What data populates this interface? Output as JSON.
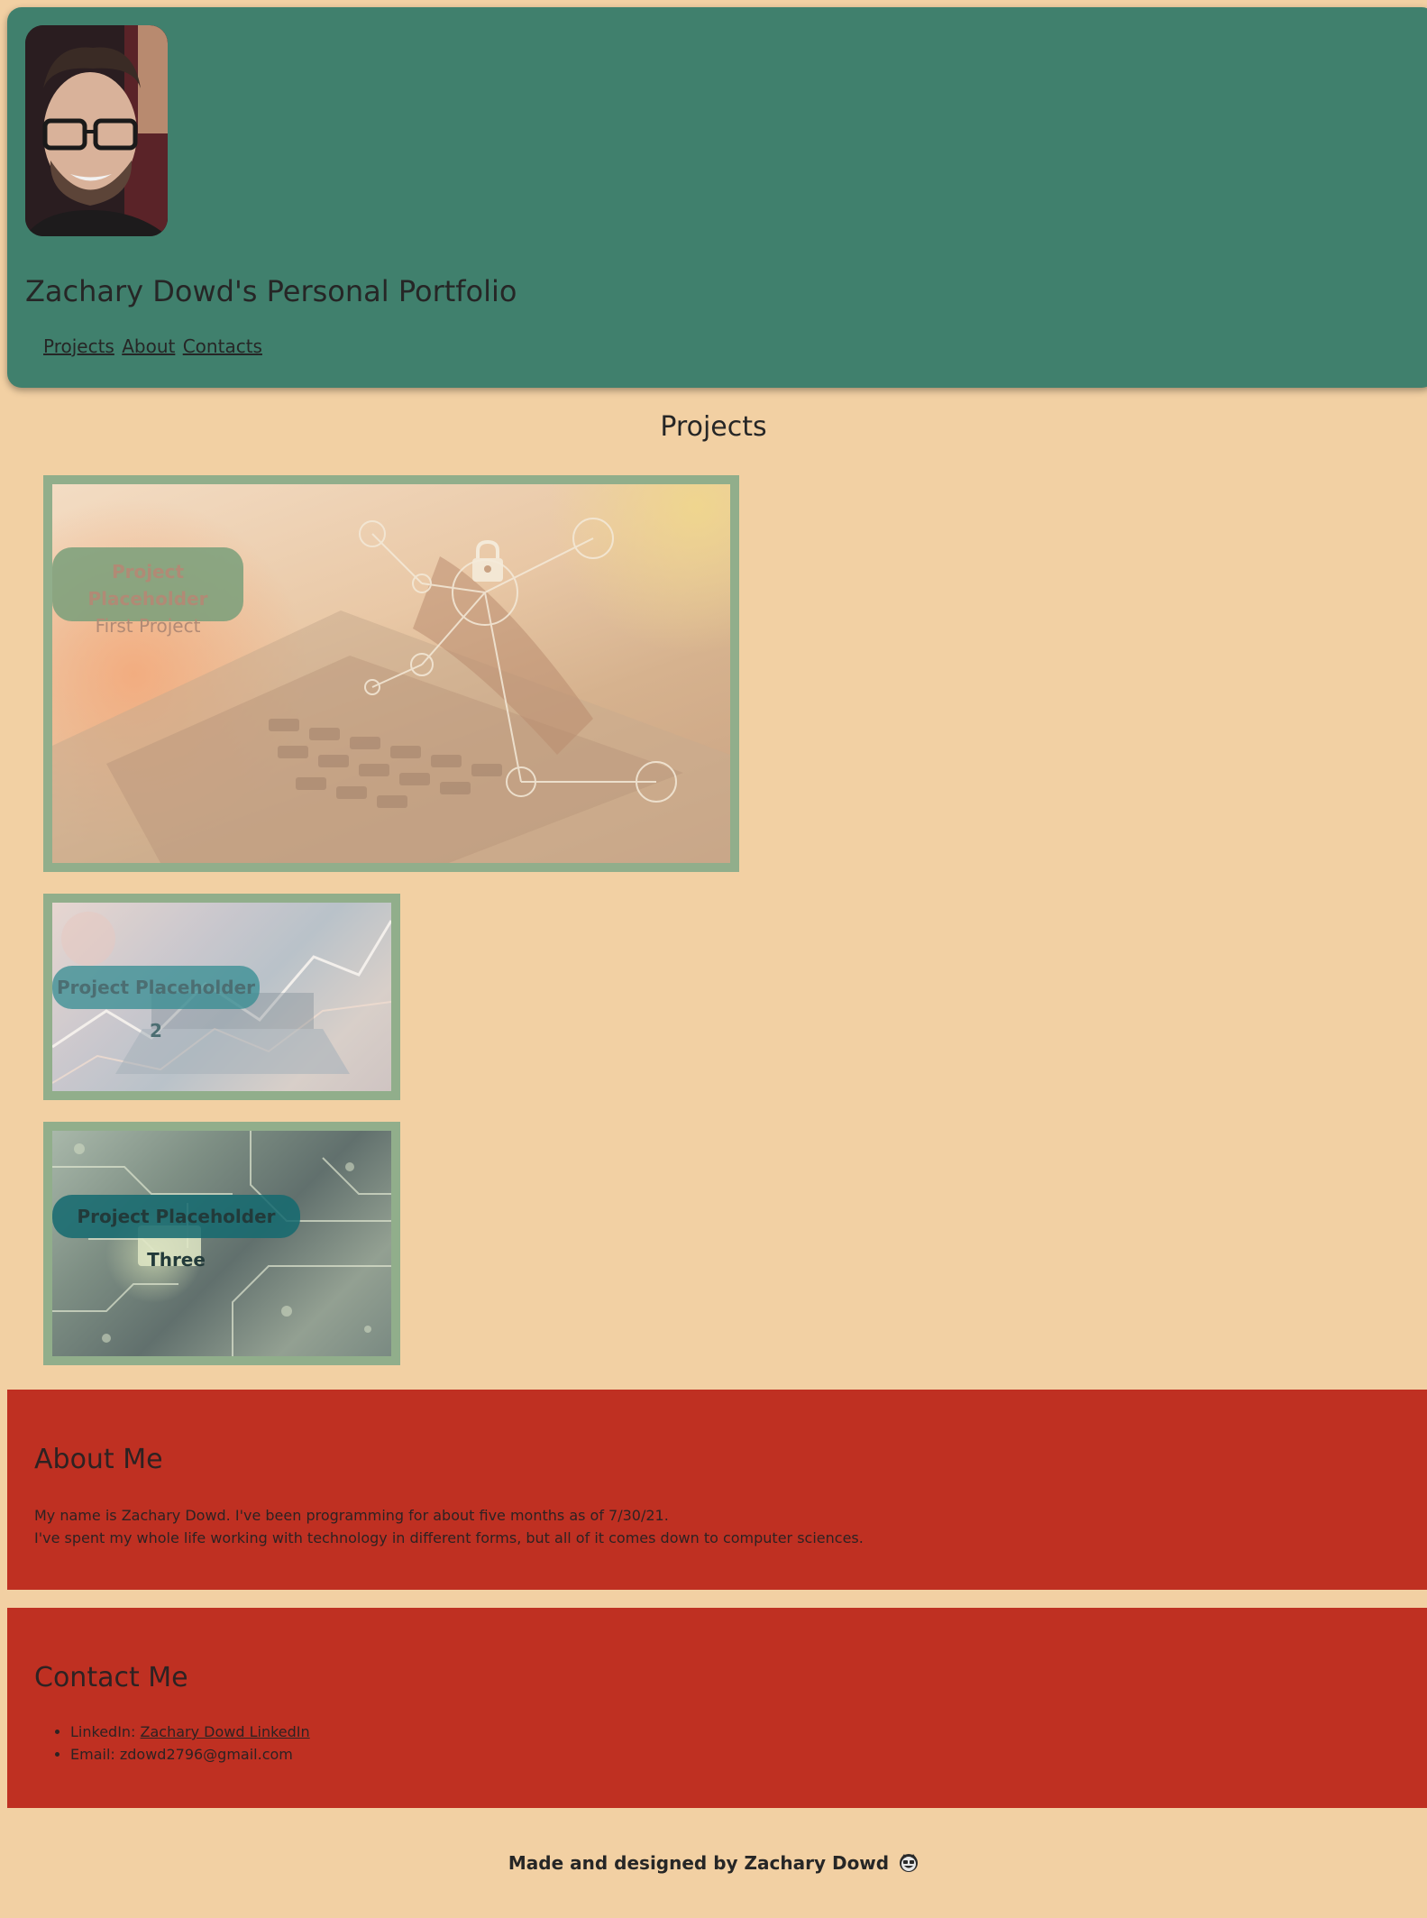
{
  "header": {
    "title": "Zachary Dowd's Personal Portfolio",
    "nav": [
      "Projects",
      "About",
      "Contacts"
    ]
  },
  "projects": {
    "heading": "Projects",
    "items": [
      {
        "title": "Project Placeholder",
        "subtitle": "First Project"
      },
      {
        "title": "Project Placeholder 2"
      },
      {
        "title": "Project Placeholder Three"
      }
    ]
  },
  "about": {
    "heading": "About Me",
    "lines": [
      "My name is Zachary Dowd. I've been programming for about five months as of 7/30/21.",
      "I've spent my whole life working with technology in different forms, but all of it comes down to computer sciences."
    ]
  },
  "contact": {
    "heading": "Contact Me",
    "linkedin_label": "LinkedIn: ",
    "linkedin_link": "Zachary Dowd LinkedIn",
    "email": "Email: zdowd2796@gmail.com"
  },
  "footer": {
    "text": "Made and designed by Zachary Dowd",
    "icon": "smiling-face-icon"
  },
  "colors": {
    "page_bg": "#f2d0a3",
    "header_bg": "#40806d",
    "section_bg": "#bf3022",
    "card_border": "#91ae8b"
  }
}
